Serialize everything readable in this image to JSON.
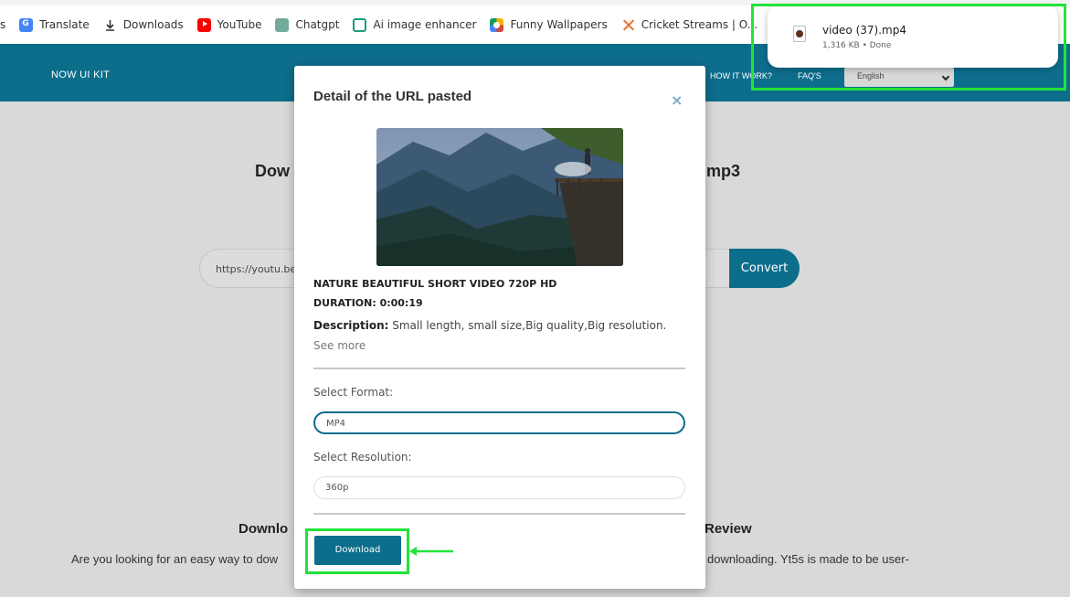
{
  "bookmarks": [
    {
      "label": "s",
      "icon": "none"
    },
    {
      "label": "Translate",
      "icon": "google-translate-icon"
    },
    {
      "label": "Downloads",
      "icon": "download-icon"
    },
    {
      "label": "YouTube",
      "icon": "youtube-icon"
    },
    {
      "label": "Chatgpt",
      "icon": "chatgpt-icon"
    },
    {
      "label": "Ai image enhancer",
      "icon": "ai-enhancer-icon"
    },
    {
      "label": "Funny Wallpapers",
      "icon": "funny-wallpapers-icon"
    },
    {
      "label": "Cricket Streams | O...",
      "icon": "cricket-icon"
    }
  ],
  "header": {
    "brand": "NOW UI KIT",
    "nav": [
      "HOW IT WORK?",
      "FAQ'S"
    ],
    "language": "English",
    "color": "#0d6e8c"
  },
  "background": {
    "title_left": "Dow",
    "title_right": "mp3",
    "url_value": "https://youtu.be/",
    "convert_label": "Convert",
    "h2_left": "Downlo",
    "h2_right": "Review",
    "para_left": "Are you looking for an easy way to dow",
    "para_right": "downloading. Yt5s is made to be user-"
  },
  "download_popup": {
    "filename": "video (37).mp4",
    "meta": "1,316 KB • Done"
  },
  "modal": {
    "title": "Detail of the URL pasted",
    "close": "×",
    "video_title": "NATURE BEAUTIFUL SHORT VIDEO 720P HD",
    "duration": "DURATION: 0:00:19",
    "description_label": "Description:",
    "description": " Small length, small size,Big quality,Big resolution.",
    "see_more": "See more",
    "format_label": "Select Format:",
    "format_value": "MP4",
    "resolution_label": "Select Resolution:",
    "resolution_value": "360p",
    "download_label": "Download"
  },
  "colors": {
    "highlight": "#22e33a",
    "primary": "#0d6e8c"
  }
}
